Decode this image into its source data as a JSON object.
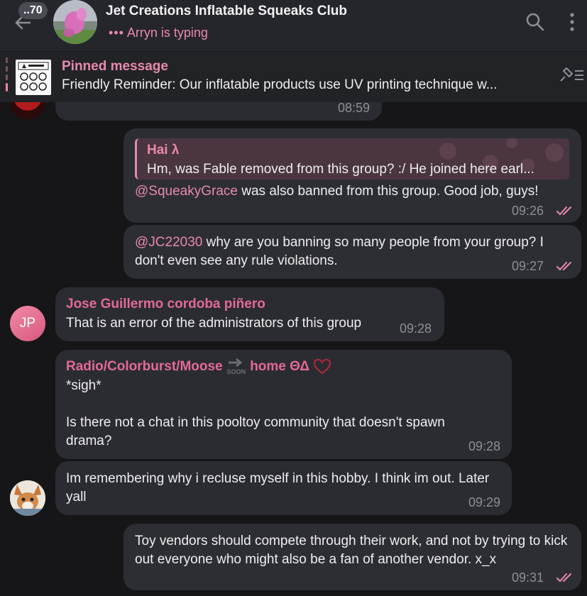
{
  "header": {
    "unread_count": "..70",
    "title": "Jet Creations Inflatable Squeaks Club",
    "typing_dots": "•••",
    "typing_status": "Arryn is typing"
  },
  "pinned": {
    "title": "Pinned message",
    "text": "Friendly Reminder: Our inflatable products use UV printing technique w..."
  },
  "messages": [
    {
      "time": "08:59"
    },
    {
      "reply_author": "Hai λ",
      "reply_text": "Hm, was Fable removed from this group? :/  He joined here earl...",
      "mention": "@SqueakyGrace",
      "text": " was also banned from this group. Good job, guys!",
      "time": "09:26"
    },
    {
      "mention": "@JC22030",
      "text": " why are you banning so many people from your group? I don't even see any rule violations.",
      "time": "09:27"
    },
    {
      "avatar_initials": "JP",
      "sender": "Jose Guillermo cordoba piñero",
      "text": "That is an error of the administrators of this group",
      "time": "09:28"
    },
    {
      "sender_part1": "Radio/Colorburst/Moose",
      "sender_soon": "SOON",
      "sender_part2": "home ΘΔ",
      "text": "*sigh*\n\nIs there not a chat in this pooltoy community that doesn't spawn drama?",
      "time": "09:28"
    },
    {
      "text": "Im remembering why i recluse myself in this hobby. I think im out. Later yall",
      "time": "09:29"
    },
    {
      "text": "Toy vendors should compete through their work, and not by trying to kick out everyone who might also be a fan of another vendor. x_x",
      "time": "09:31"
    }
  ],
  "colors": {
    "accent_pink": "#e889ad",
    "sender_pink": "#e26a96",
    "bubble": "#2b2c31",
    "background": "#161619",
    "read_checks": "#e889ad"
  },
  "icons": [
    "back-arrow-icon",
    "search-icon",
    "more-vert-icon",
    "unpin-icon",
    "double-check-icon",
    "heart-icon"
  ]
}
